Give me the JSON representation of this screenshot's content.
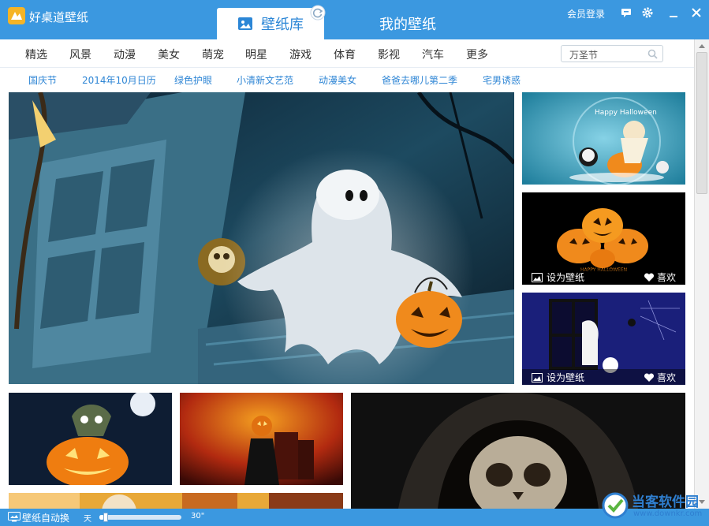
{
  "app": {
    "title": "好桌道壁纸"
  },
  "tabs": [
    {
      "label": "壁纸库",
      "active": true
    },
    {
      "label": "我的壁纸",
      "active": false
    }
  ],
  "header": {
    "login_label": "会员登录"
  },
  "nav": {
    "categories": [
      "精选",
      "风景",
      "动漫",
      "美女",
      "萌宠",
      "明星",
      "游戏",
      "体育",
      "影视",
      "汽车",
      "更多"
    ],
    "search_value": "万圣节"
  },
  "tags": [
    "国庆节",
    "2014年10月日历",
    "绿色护眼",
    "小清新文艺范",
    "动漫美女",
    "爸爸去哪儿第二季",
    "宅男诱惑"
  ],
  "tile_actions": {
    "set_label": "设为壁纸",
    "like_label": "喜欢"
  },
  "gallery": {
    "tile_texts": {
      "happy_halloween": "Happy Halloween",
      "happy_halloween_caps": "HAPPY HALLOWEEN"
    }
  },
  "statusbar": {
    "auto_label": "壁纸自动换",
    "slider_min": "天",
    "slider_max": "30\"",
    "slider_value": 0.05
  },
  "watermark": {
    "name": "当客软件园",
    "url": "www.downkr.com"
  },
  "colors": {
    "accent": "#3b98e0",
    "tab_active_text": "#2b86d6",
    "tag_text": "#2f86d5"
  }
}
